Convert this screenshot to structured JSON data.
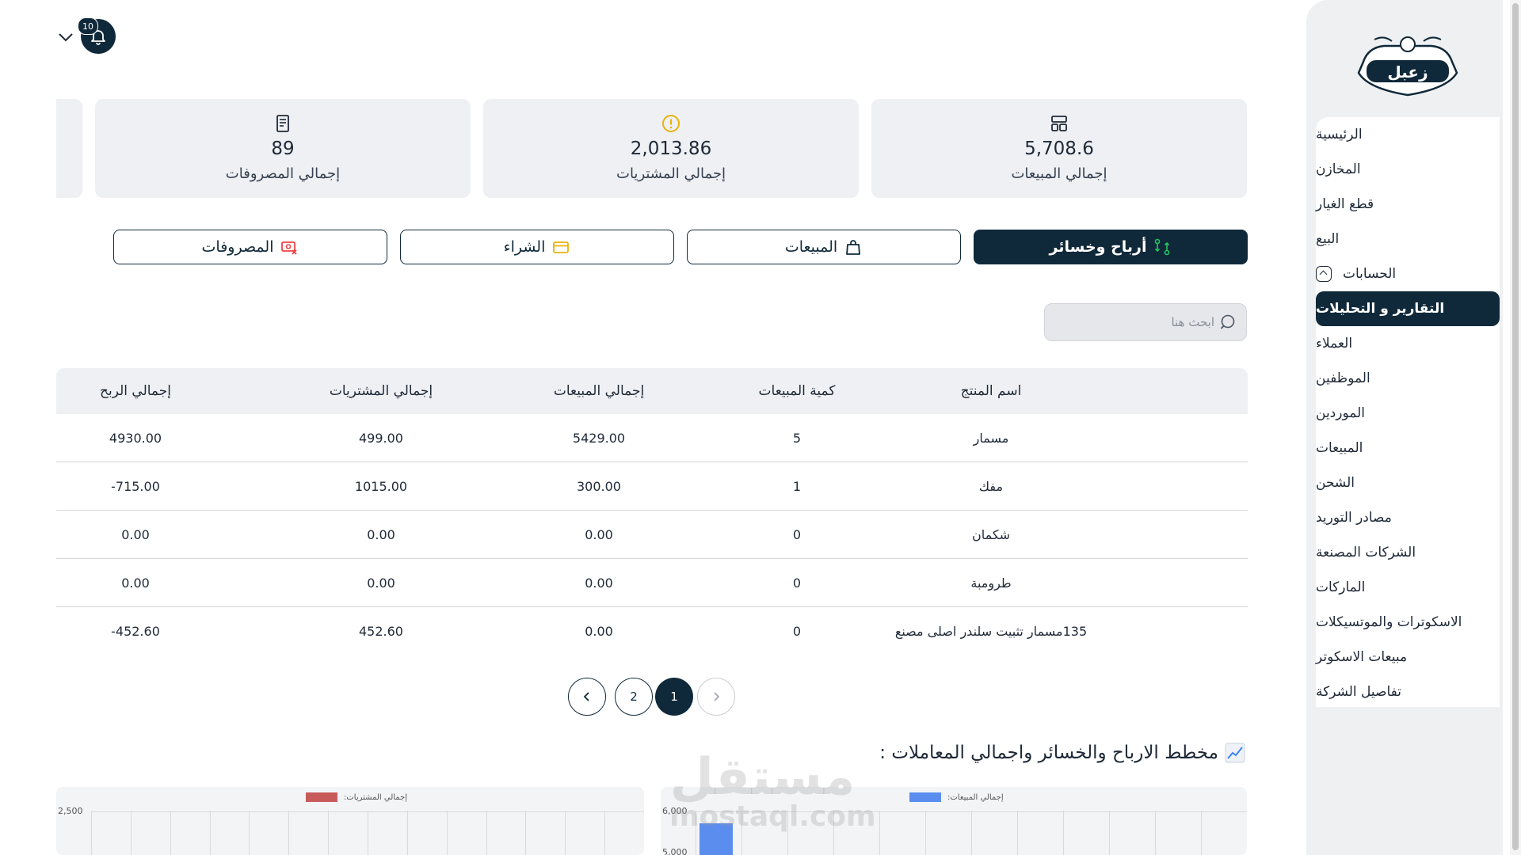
{
  "brand": {
    "logo_text": "زعبل"
  },
  "notifications": {
    "count": "10"
  },
  "sidebar": {
    "items": [
      {
        "label": "الرئيسية"
      },
      {
        "label": "المخازن"
      },
      {
        "label": "قطع الغيار"
      },
      {
        "label": "البيع"
      },
      {
        "label": "الحسابات"
      },
      {
        "label": "التقارير و التحليلات"
      },
      {
        "label": "العملاء"
      },
      {
        "label": "الموظفين"
      },
      {
        "label": "الموردين"
      },
      {
        "label": "المبيعات"
      },
      {
        "label": "الشحن"
      },
      {
        "label": "مصادر التوريد"
      },
      {
        "label": "الشركات المصنعة"
      },
      {
        "label": "الماركات"
      },
      {
        "label": "الاسكوترات والموتسيكلات"
      },
      {
        "label": "مبيعات الاسكوتر"
      },
      {
        "label": "تفاصيل الشركة"
      }
    ],
    "active_index": 5
  },
  "stats": {
    "sales": {
      "value": "5,708.6",
      "label": "إجمالي المبيعات",
      "icon": "grid-icon"
    },
    "purchases": {
      "value": "2,013.86",
      "label": "إجمالي المشتريات",
      "icon": "warning-circle-icon"
    },
    "expenses": {
      "value": "89",
      "label": "إجمالي المصروفات",
      "icon": "receipt-icon"
    }
  },
  "tabs": [
    {
      "label": "أرباح وخسائر",
      "icon": "exchange-icon"
    },
    {
      "label": "المبيعات",
      "icon": "bag-icon"
    },
    {
      "label": "الشراء",
      "icon": "card-icon"
    },
    {
      "label": "المصروفات",
      "icon": "money-icon"
    }
  ],
  "search": {
    "placeholder": "ابحث هنا"
  },
  "table": {
    "headers": {
      "name": "اسم المنتج",
      "qty": "كمية المبيعات",
      "sales": "إجمالي المبيعات",
      "purchases": "إجمالي المشتريات",
      "profit": "إجمالي الربح"
    },
    "rows": [
      {
        "name": "مسمار",
        "qty": "5",
        "sales": "5429.00",
        "purchases": "499.00",
        "profit": "4930.00"
      },
      {
        "name": "مفك",
        "qty": "1",
        "sales": "300.00",
        "purchases": "1015.00",
        "profit": "-715.00"
      },
      {
        "name": "شكمان",
        "qty": "0",
        "sales": "0.00",
        "purchases": "0.00",
        "profit": "0.00"
      },
      {
        "name": "طرومبة",
        "qty": "0",
        "sales": "0.00",
        "purchases": "0.00",
        "profit": "0.00"
      },
      {
        "name": "135مسمار تثبيت سلندر اصلى مصنع",
        "qty": "0",
        "sales": "0.00",
        "purchases": "452.60",
        "profit": "-452.60"
      }
    ]
  },
  "pagination": {
    "pages": [
      "1",
      "2"
    ],
    "current": "1"
  },
  "chart_section": {
    "title": "مخطط الارباح والخسائر واجمالي المعاملات :"
  },
  "chart_data": [
    {
      "type": "bar",
      "series": [
        {
          "name": "إجمالي المبيعات:",
          "values": [
            5708.6
          ]
        }
      ],
      "ticks_visible": [
        "6,000",
        "5,000"
      ],
      "color": "#5b8def"
    },
    {
      "type": "bar",
      "series": [
        {
          "name": "إجمالي المشتريات:",
          "values": []
        }
      ],
      "ticks_visible": [
        "2,500"
      ],
      "color": "#c85a5a"
    }
  ],
  "watermark": {
    "line1": "مستقل",
    "line2": "mostaql.com"
  },
  "colors": {
    "primary": "#10293a",
    "card_bg": "#eef0f3",
    "accent_green": "#22c55e",
    "accent_yellow": "#eab308",
    "accent_red": "#ef4444"
  }
}
